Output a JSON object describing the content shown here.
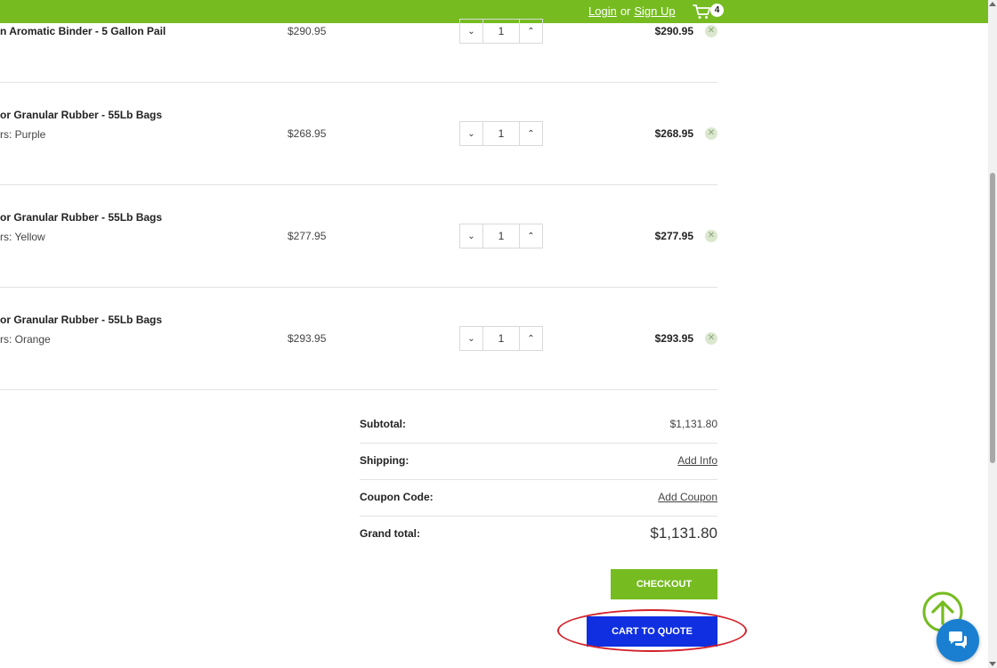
{
  "header": {
    "login_label": "Login",
    "or_label": "or",
    "signup_label": "Sign Up",
    "cart_count": "4"
  },
  "items": [
    {
      "name": "n Aromatic Binder - 5 Gallon Pail",
      "option": "",
      "price": "$290.95",
      "qty": "1",
      "total": "$290.95"
    },
    {
      "name": "or Granular Rubber - 55Lb Bags",
      "option": "rs: Purple",
      "price": "$268.95",
      "qty": "1",
      "total": "$268.95"
    },
    {
      "name": "or Granular Rubber - 55Lb Bags",
      "option": "rs: Yellow",
      "price": "$277.95",
      "qty": "1",
      "total": "$277.95"
    },
    {
      "name": "or Granular Rubber - 55Lb Bags",
      "option": "rs: Orange",
      "price": "$293.95",
      "qty": "1",
      "total": "$293.95"
    }
  ],
  "summary": {
    "subtotal_label": "Subtotal:",
    "subtotal_value": "$1,131.80",
    "shipping_label": "Shipping:",
    "shipping_link": "Add Info",
    "coupon_label": "Coupon Code:",
    "coupon_link": "Add Coupon",
    "grand_label": "Grand total:",
    "grand_value": "$1,131.80"
  },
  "actions": {
    "checkout_label": "CHECKOUT",
    "quote_label": "CART TO QUOTE"
  },
  "colors": {
    "brand_green": "#76bc21",
    "quote_blue": "#0f2fe0",
    "highlight_red": "#d4222a",
    "chat_blue": "#1a7fd0"
  },
  "icons": {
    "cart": "cart-icon",
    "remove": "close-icon",
    "decrease": "chevron-down-icon",
    "increase": "chevron-up-icon",
    "back_to_top": "arrow-up-circle-icon",
    "chat": "chat-bubble-icon"
  }
}
